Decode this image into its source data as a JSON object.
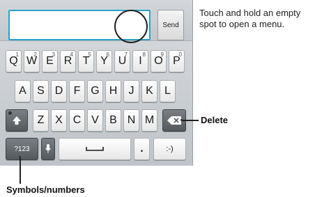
{
  "compose": {
    "send_label": "Send"
  },
  "keyboard": {
    "row1": [
      {
        "label": "Q",
        "alt": "1"
      },
      {
        "label": "W",
        "alt": "2"
      },
      {
        "label": "E",
        "alt": "3"
      },
      {
        "label": "R",
        "alt": "4"
      },
      {
        "label": "T",
        "alt": "5"
      },
      {
        "label": "Y",
        "alt": "6"
      },
      {
        "label": "U",
        "alt": "7"
      },
      {
        "label": "I",
        "alt": "8"
      },
      {
        "label": "O",
        "alt": "9"
      },
      {
        "label": "P",
        "alt": "0"
      }
    ],
    "row2": [
      "A",
      "S",
      "D",
      "F",
      "G",
      "H",
      "J",
      "K",
      "L"
    ],
    "row3": [
      "Z",
      "X",
      "C",
      "V",
      "B",
      "N",
      "M"
    ],
    "shift_icon": "shift-arrow-icon",
    "delete_icon": "backspace-icon",
    "mic_icon": "microphone-icon",
    "space_icon": "spacebar-icon",
    "symbols_label": "?123",
    "period_label": ".",
    "smiley_label": ":-)"
  },
  "callouts": {
    "menu_hint": "Touch and hold an empty spot to open a menu.",
    "delete_label": "Delete",
    "symbols_label": "Symbols/numbers"
  },
  "colors": {
    "text_field_border": "#29a3cc",
    "dark_key": "#54595e"
  }
}
